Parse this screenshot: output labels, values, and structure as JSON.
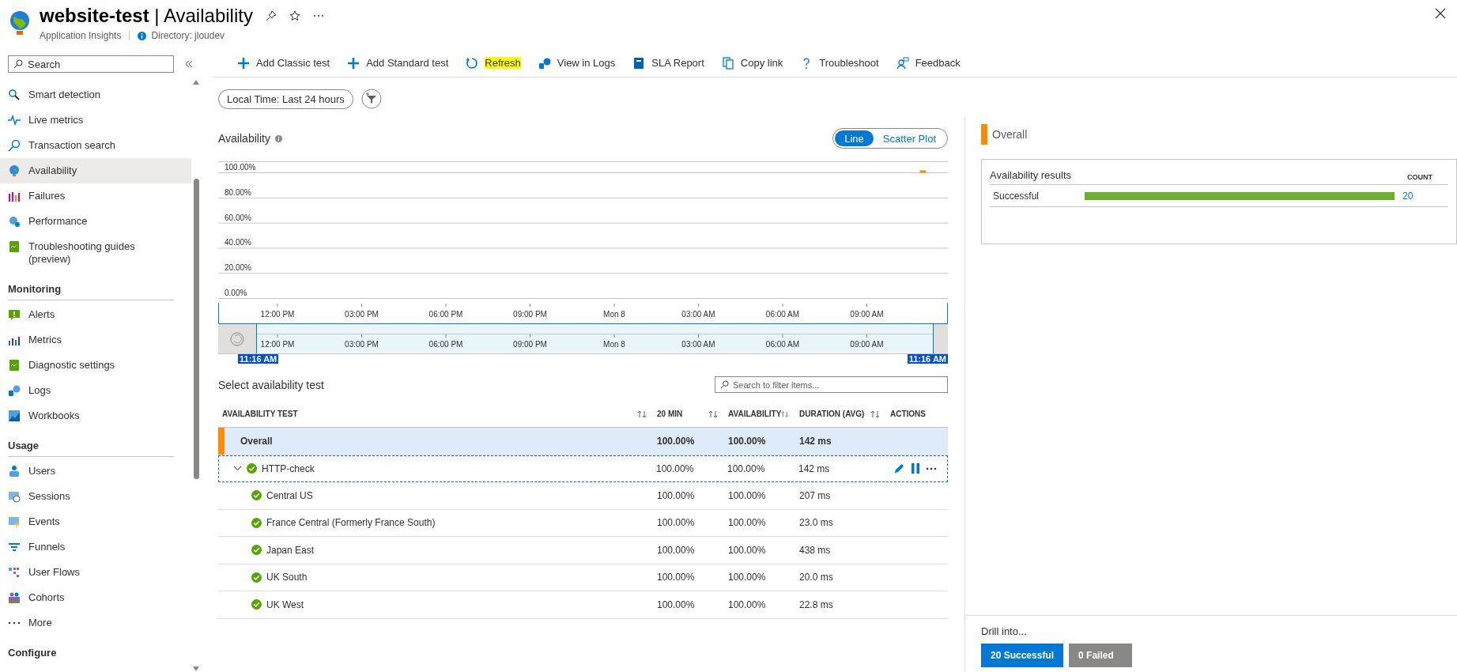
{
  "header": {
    "title": "**website-test** | Availability",
    "subtitle": "Application Insights",
    "directory": "Directory: jloudev"
  },
  "sidebar": {
    "search": {
      "placeholder": "Search"
    },
    "items": [
      {
        "label": "Smart detection",
        "selected": false
      },
      {
        "label": "Live metrics",
        "selected": false
      },
      {
        "label": "Transaction search",
        "selected": false
      },
      {
        "label": "Availability",
        "selected": true
      },
      {
        "label": "Failures",
        "selected": false
      },
      {
        "label": "Performance",
        "selected": false
      },
      {
        "label": "Troubleshooting guides (preview)",
        "selected": false
      }
    ],
    "sections": [
      {
        "title": "Monitoring",
        "items": [
          {
            "label": "Alerts",
            "selected": false
          },
          {
            "label": "Metrics",
            "selected": false
          },
          {
            "label": "Diagnostic settings",
            "selected": false
          },
          {
            "label": "Logs",
            "selected": false
          },
          {
            "label": "Workbooks",
            "selected": false
          }
        ]
      },
      {
        "title": "Usage",
        "items": [
          {
            "label": "Users",
            "selected": false
          },
          {
            "label": "Sessions",
            "selected": false
          },
          {
            "label": "Events",
            "selected": false
          },
          {
            "label": "Funnels",
            "selected": false
          },
          {
            "label": "User Flows",
            "selected": false
          },
          {
            "label": "Cohorts",
            "selected": false
          },
          {
            "label": "More",
            "selected": false
          }
        ]
      },
      {
        "title": "Configure"
      }
    ]
  },
  "toolbar": [
    {
      "label": "Add Classic test",
      "highlighted": false
    },
    {
      "label": "Add Standard test",
      "highlighted": false
    },
    {
      "label": "Refresh",
      "highlighted": true
    },
    {
      "label": "View in Logs",
      "highlighted": false
    },
    {
      "label": "SLA Report",
      "highlighted": false
    },
    {
      "label": "Copy link",
      "highlighted": false
    },
    {
      "label": "Troubleshoot",
      "highlighted": false
    },
    {
      "label": "Feedback",
      "highlighted": false
    }
  ],
  "time_filter": {
    "label": "Local Time: Last 24 hours"
  },
  "chart_section": {
    "title": "Availability",
    "view_toggle": [
      {
        "label": "Line",
        "selected": true
      },
      {
        "label": "Scatter Plot",
        "selected": false
      }
    ],
    "chart_data": {
      "type": "line",
      "ylim": [
        0,
        100
      ],
      "grid": true,
      "categories": [
        "12:00 PM",
        null,
        null,
        "03:00 PM",
        null,
        null,
        "06:00 PM",
        null,
        null,
        "09:00 PM",
        null,
        null,
        "Mon 8",
        null,
        null,
        "03:00 AM",
        null,
        null,
        "06:00 AM",
        null,
        null,
        "09:00 AM",
        null,
        null
      ],
      "series": [
        {
          "name": "Overall",
          "color": "#ff8c00",
          "marker": "square",
          "values": [
            null,
            null,
            null,
            null,
            null,
            null,
            null,
            null,
            null,
            null,
            null,
            null,
            null,
            null,
            null,
            null,
            null,
            null,
            null,
            null,
            null,
            null,
            null,
            100
          ]
        }
      ],
      "yticks": [
        {
          "value": 0,
          "label": "0.00%"
        },
        {
          "value": 20,
          "label": "20.00%"
        },
        {
          "value": 40,
          "label": "40.00%"
        },
        {
          "value": 60,
          "label": "60.00%"
        },
        {
          "value": 80,
          "label": "80.00%"
        },
        {
          "value": 100,
          "label": "100.00%"
        }
      ]
    },
    "range_selector": {
      "ticks": [
        "12:00 PM",
        "03:00 PM",
        "06:00 PM",
        "09:00 PM",
        "Mon 8",
        "03:00 AM",
        "06:00 AM",
        "09:00 AM"
      ],
      "start_label": "11:16 AM",
      "end_label": "11:16 AM"
    }
  },
  "test_list": {
    "title": "Select availability test",
    "search": {
      "placeholder": "Search to filter items..."
    },
    "columns": [
      {
        "label": "AVAILABILITY TEST",
        "sortable": true
      },
      {
        "label": "20 MIN",
        "sortable": true
      },
      {
        "label": "AVAILABILITY",
        "sortable": true
      },
      {
        "label": "DURATION (AVG)",
        "sortable": true
      },
      {
        "label": "ACTIONS",
        "sortable": false
      }
    ],
    "rows": [
      {
        "kind": "overall",
        "name": "Overall",
        "min20": "100.00%",
        "availability": "100.00%",
        "duration": "142 ms",
        "selected": true,
        "focused": false
      },
      {
        "kind": "test",
        "name": "HTTP-check",
        "expanded": true,
        "min20": "100.00%",
        "availability": "100.00%",
        "duration": "142 ms",
        "selected": false,
        "focused": true,
        "children": [
          {
            "kind": "location",
            "name": "Central US",
            "min20": "100.00%",
            "availability": "100.00%",
            "duration": "207 ms",
            "selected": false,
            "focused": false
          },
          {
            "kind": "location",
            "name": "France Central (Formerly France South)",
            "min20": "100.00%",
            "availability": "100.00%",
            "duration": "23.0 ms",
            "selected": false,
            "focused": false
          },
          {
            "kind": "location",
            "name": "Japan East",
            "min20": "100.00%",
            "availability": "100.00%",
            "duration": "438 ms",
            "selected": false,
            "focused": false
          },
          {
            "kind": "location",
            "name": "UK South",
            "min20": "100.00%",
            "availability": "100.00%",
            "duration": "20.0 ms",
            "selected": false,
            "focused": false
          },
          {
            "kind": "location",
            "name": "UK West",
            "min20": "100.00%",
            "availability": "100.00%",
            "duration": "22.8 ms",
            "selected": false,
            "focused": false
          }
        ]
      }
    ]
  },
  "right_panel": {
    "results_card": {
      "title": "Availability results",
      "count_heading": "COUNT",
      "rows": [
        {
          "label": "Successful",
          "level": 1,
          "count": "20"
        }
      ]
    },
    "drill": {
      "title": "Drill into...",
      "buttons": [
        {
          "label": "20 Successful",
          "disabled": false
        },
        {
          "label": "0 Failed",
          "disabled": true
        }
      ]
    }
  }
}
